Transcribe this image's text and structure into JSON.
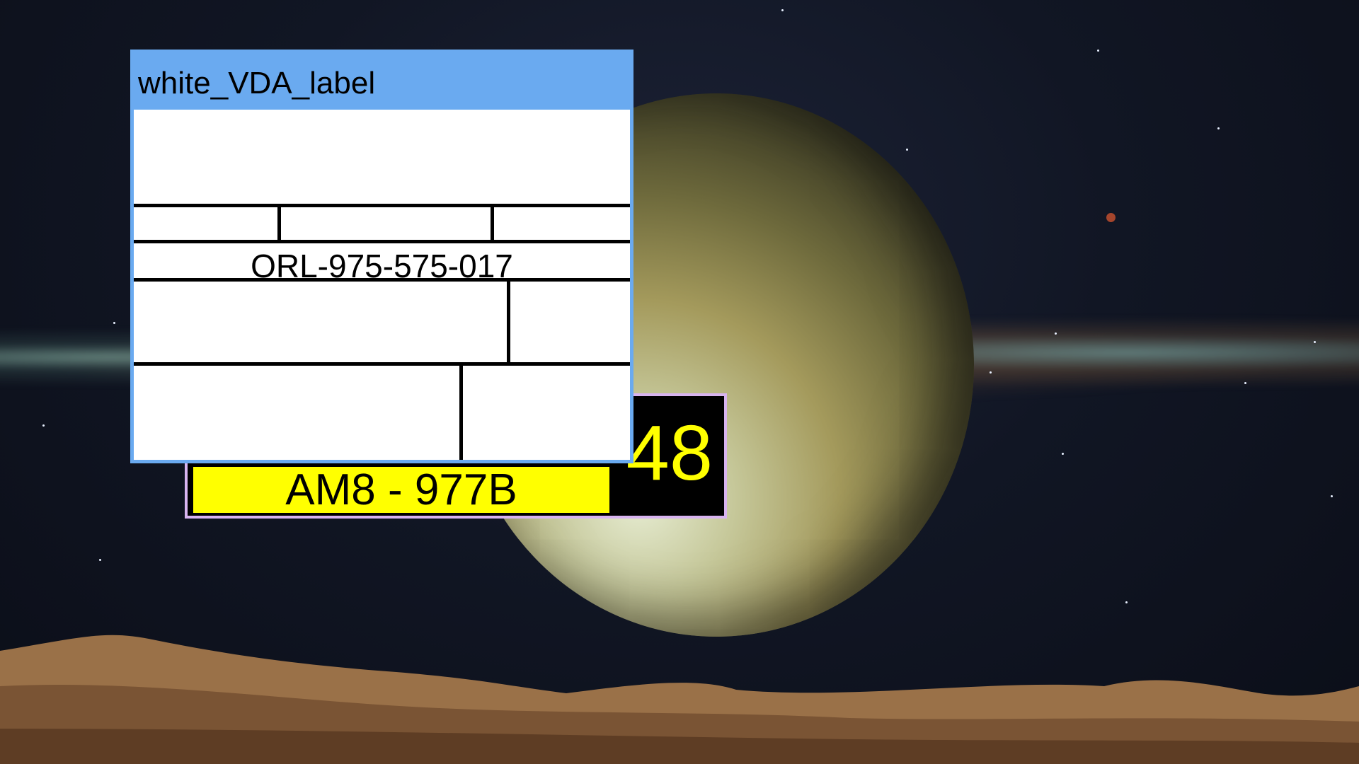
{
  "window": {
    "title": "white_VDA_label"
  },
  "vda_label": {
    "barcode_text": "ORL-975-575-017"
  },
  "plate_label": {
    "plate_text": "AM8 - 977B",
    "number": "48"
  },
  "colors": {
    "titlebar": "#6aaaf0",
    "plate_yellow": "#ffff00",
    "plate_border": "#d8b4f0",
    "number_color": "#ffff00"
  }
}
